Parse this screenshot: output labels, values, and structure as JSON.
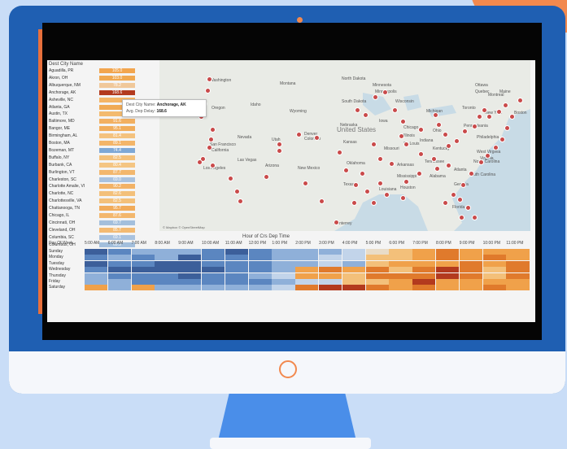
{
  "list": {
    "title": "Dest City Name",
    "rows": [
      {
        "name": "Aguadilla, PR",
        "value": "105.0",
        "color": "#f2a54e"
      },
      {
        "name": "Akron, OH",
        "value": "103.0",
        "color": "#f0a850"
      },
      {
        "name": "Albuquerque, NM",
        "value": "78.2",
        "color": "#f0c89a"
      },
      {
        "name": "Anchorage, AK",
        "value": "168.6",
        "color": "#b33a1e"
      },
      {
        "name": "Asheville, NC",
        "value": "",
        "color": "#f4b566"
      },
      {
        "name": "Atlanta, GA",
        "value": "",
        "color": "#f0aa55"
      },
      {
        "name": "Austin, TX",
        "value": "",
        "color": "#f3ba6e"
      },
      {
        "name": "Baltimore, MD",
        "value": "91.6",
        "color": "#f2b062"
      },
      {
        "name": "Bangor, ME",
        "value": "95.1",
        "color": "#f1ad5c"
      },
      {
        "name": "Birmingham, AL",
        "value": "81.4",
        "color": "#f4c27e"
      },
      {
        "name": "Boston, MA",
        "value": "89.1",
        "color": "#f3b569"
      },
      {
        "name": "Bozeman, MT",
        "value": "74.4",
        "color": "#7ea8d6"
      },
      {
        "name": "Buffalo, NY",
        "value": "82.5",
        "color": "#f3c07a"
      },
      {
        "name": "Burbank, CA",
        "value": "80.4",
        "color": "#f4c582"
      },
      {
        "name": "Burlington, VT",
        "value": "87.7",
        "color": "#f3b76d"
      },
      {
        "name": "Charleston, SC",
        "value": "69.0",
        "color": "#a9c2df"
      },
      {
        "name": "Charlotte Amalie, VI",
        "value": "90.2",
        "color": "#f2b266"
      },
      {
        "name": "Charlotte, NC",
        "value": "82.6",
        "color": "#f3c07a"
      },
      {
        "name": "Charlottesville, VA",
        "value": "82.5",
        "color": "#f3c07a"
      },
      {
        "name": "Chattanooga, TN",
        "value": "95.7",
        "color": "#f1ab5a"
      },
      {
        "name": "Chicago, IL",
        "value": "87.6",
        "color": "#f3b76d"
      },
      {
        "name": "Cincinnati, OH",
        "value": "69.7",
        "color": "#a3bfdc"
      },
      {
        "name": "Cleveland, OH",
        "value": "85.7",
        "color": "#f3ba72"
      },
      {
        "name": "Columbia, SC",
        "value": "69.1",
        "color": "#a9c2df"
      },
      {
        "name": "Columbus, OH",
        "value": "69.9",
        "color": "#a3bfdc"
      }
    ]
  },
  "tooltip": {
    "name_label": "Dest City Name:",
    "name_value": "Anchorage, AK",
    "delay_label": "Avg. Dep Delay:",
    "delay_value": "168.6"
  },
  "map": {
    "country": "United States",
    "attribution": "© Mapbox © OpenStreetMap",
    "labels": [
      "Washington",
      "Montana",
      "North Dakota",
      "Minnesota",
      "Minneapolis",
      "Oregon",
      "Idaho",
      "South Dakota",
      "Wisconsin",
      "Michigan",
      "Toronto",
      "New York",
      "Boston",
      "Wyoming",
      "Nebraska",
      "Iowa",
      "Chicago",
      "Ohio",
      "Pennsylvania",
      "Nevada",
      "Utah",
      "Denver",
      "Colorado",
      "Kansas",
      "Illinois",
      "Indiana",
      "Philadelphia",
      "San Francisco",
      "California",
      "St. Louis",
      "Missouri",
      "Kentucky",
      "West Virginia",
      "Virginia",
      "Las Vegas",
      "Los Angeles",
      "Arizona",
      "New Mexico",
      "Oklahoma",
      "Arkansas",
      "Tennessee",
      "North Carolina",
      "Atlanta",
      "South Carolina",
      "Mississippi",
      "Alabama",
      "Georgia",
      "Texas",
      "Louisiana",
      "Houston",
      "Florida",
      "Monterrey",
      "Maine",
      "Quebec",
      "Ottawa",
      "Montreal"
    ]
  },
  "heatmap": {
    "title": "Hour of Crs Dep Time",
    "corner": "Day Of Week",
    "hours": [
      "5:00 AM",
      "6:00 AM",
      "7:00 AM",
      "8:00 AM",
      "9:00 AM",
      "10:00 AM",
      "11:00 AM",
      "12:00 PM",
      "1:00 PM",
      "2:00 PM",
      "3:00 PM",
      "4:00 PM",
      "5:00 PM",
      "6:00 PM",
      "7:00 PM",
      "8:00 PM",
      "9:00 PM",
      "10:00 PM",
      "11:00 PM"
    ],
    "days": [
      "Sunday",
      "Monday",
      "Tuesday",
      "Wednesday",
      "Thursday",
      "Friday",
      "Saturday"
    ]
  },
  "colors": {
    "monitor": "#1f5fb2",
    "accent": "#f2894e",
    "background": "#c9ddf7"
  }
}
